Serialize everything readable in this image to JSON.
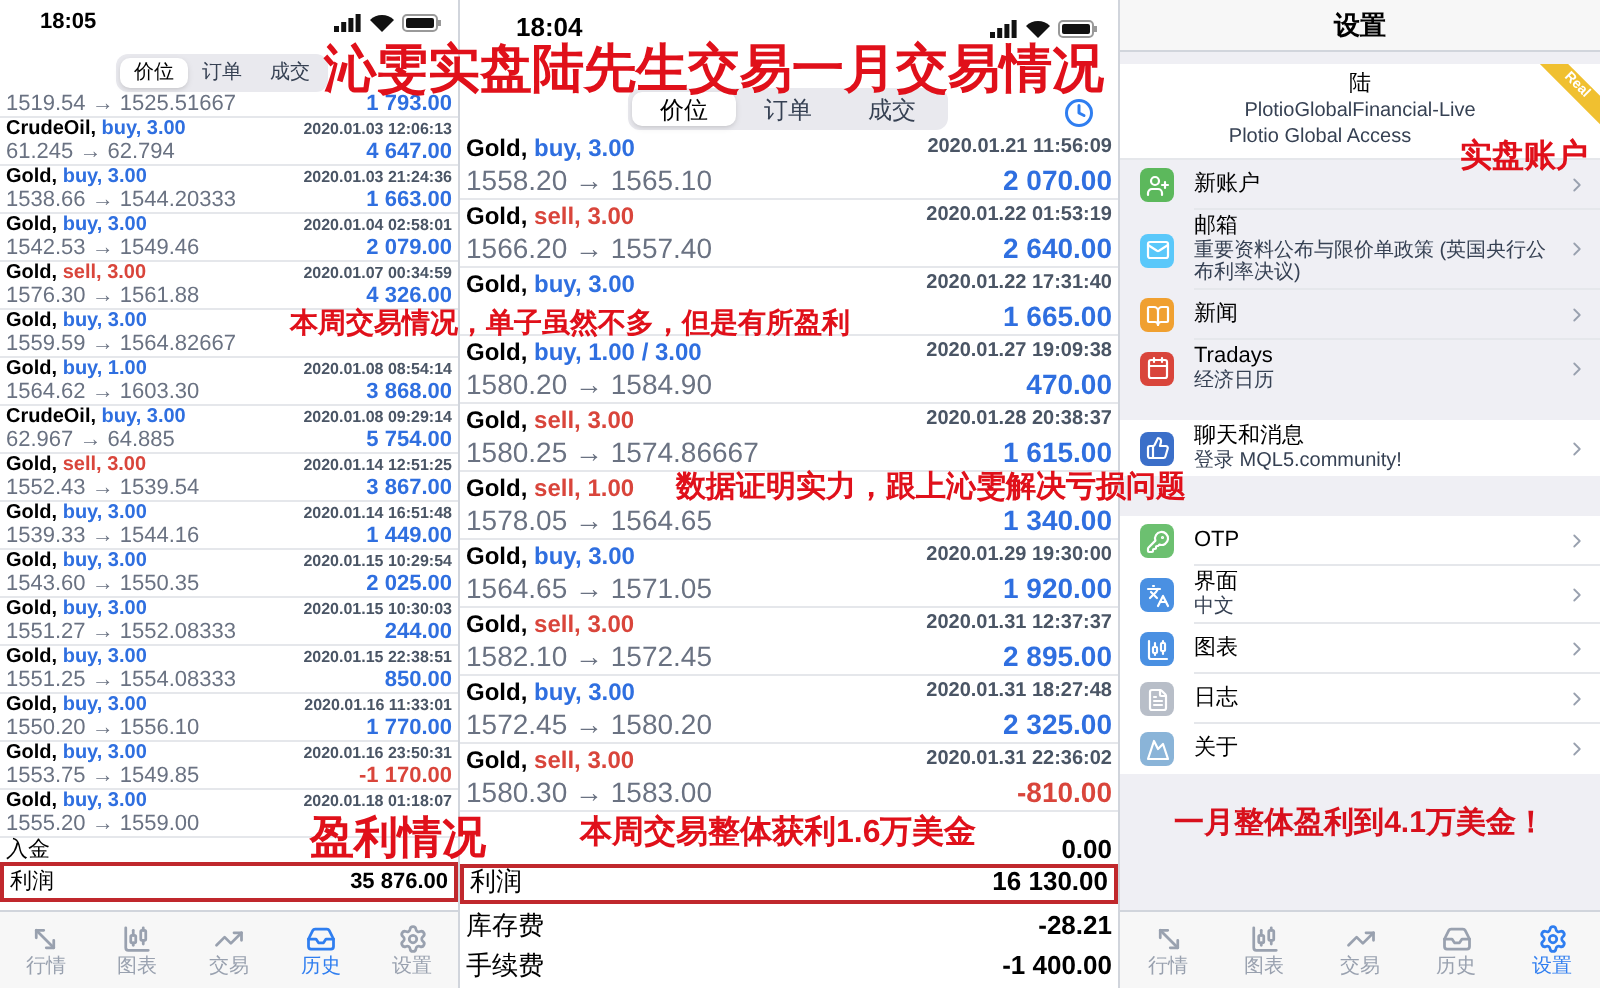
{
  "headline": "沁雯实盘陆先生交易一月交易情况",
  "captions": [
    "本周交易情况，单子虽然不多，但是有所盈利",
    "数据证明实力，跟上沁雯解决亏损问题",
    "盈利情况",
    "本周交易整体获利1.6万美金",
    "实盘账户"
  ],
  "left_phone": {
    "status_time": "18:05",
    "tabs": [
      {
        "label": "价位",
        "selected": true
      },
      {
        "label": "订单",
        "selected": false
      },
      {
        "label": "成交",
        "selected": false
      }
    ],
    "trades": [
      {
        "prices": "1519.54 → 1525.51667",
        "profit": "1 793.00",
        "loss": false
      },
      {
        "symbol": "CrudeOil,",
        "order": "buy, 3.00",
        "kind": "buy",
        "time": "2020.01.03 12:06:13",
        "prices": "61.245 → 62.794",
        "profit": "4 647.00",
        "loss": false
      },
      {
        "symbol": "Gold,",
        "order": "buy, 3.00",
        "kind": "buy",
        "time": "2020.01.03 21:24:36",
        "prices": "1538.66 → 1544.20333",
        "profit": "1 663.00",
        "loss": false
      },
      {
        "symbol": "Gold,",
        "order": "buy, 3.00",
        "kind": "buy",
        "time": "2020.01.04 02:58:01",
        "prices": "1542.53 → 1549.46",
        "profit": "2 079.00",
        "loss": false
      },
      {
        "symbol": "Gold,",
        "order": "sell, 3.00",
        "kind": "sell",
        "time": "2020.01.07 00:34:59",
        "prices": "1576.30 → 1561.88",
        "profit": "4 326.00",
        "loss": false
      },
      {
        "symbol": "Gold,",
        "order": "buy, 3.00",
        "kind": "buy",
        "prices": "1559.59 → 1564.82667"
      },
      {
        "symbol": "Gold,",
        "order": "buy, 1.00",
        "kind": "buy",
        "time": "2020.01.08 08:54:14",
        "prices": "1564.62 → 1603.30",
        "profit": "3 868.00",
        "loss": false
      },
      {
        "symbol": "CrudeOil,",
        "order": "buy, 3.00",
        "kind": "buy",
        "time": "2020.01.08 09:29:14",
        "prices": "62.967 → 64.885",
        "profit": "5 754.00",
        "loss": false
      },
      {
        "symbol": "Gold,",
        "order": "sell, 3.00",
        "kind": "sell",
        "time": "2020.01.14 12:51:25",
        "prices": "1552.43 → 1539.54",
        "profit": "3 867.00",
        "loss": false
      },
      {
        "symbol": "Gold,",
        "order": "buy, 3.00",
        "kind": "buy",
        "time": "2020.01.14 16:51:48",
        "prices": "1539.33 → 1544.16",
        "profit": "1 449.00",
        "loss": false
      },
      {
        "symbol": "Gold,",
        "order": "buy, 3.00",
        "kind": "buy",
        "time": "2020.01.15 10:29:54",
        "prices": "1543.60 → 1550.35",
        "profit": "2 025.00",
        "loss": false
      },
      {
        "symbol": "Gold,",
        "order": "buy, 3.00",
        "kind": "buy",
        "time": "2020.01.15 10:30:03",
        "prices": "1551.27 → 1552.08333",
        "profit": "244.00",
        "loss": false
      },
      {
        "symbol": "Gold,",
        "order": "buy, 3.00",
        "kind": "buy",
        "time": "2020.01.15 22:38:51",
        "prices": "1551.25 → 1554.08333",
        "profit": "850.00",
        "loss": false
      },
      {
        "symbol": "Gold,",
        "order": "buy, 3.00",
        "kind": "buy",
        "time": "2020.01.16 11:33:01",
        "prices": "1550.20 → 1556.10",
        "profit": "1 770.00",
        "loss": false
      },
      {
        "symbol": "Gold,",
        "order": "buy, 3.00",
        "kind": "buy",
        "time": "2020.01.16 23:50:31",
        "prices": "1553.75 → 1549.85",
        "profit": "-1 170.00",
        "loss": true
      },
      {
        "symbol": "Gold,",
        "order": "buy, 3.00",
        "kind": "buy",
        "time": "2020.01.18 01:18:07",
        "prices": "1555.20 → 1559.00"
      }
    ],
    "summary": [
      {
        "label": "入金",
        "highlighted": false
      },
      {
        "label": "利润",
        "value": "35 876.00",
        "highlighted": true
      }
    ],
    "tab_bar": [
      {
        "label": "行情",
        "selected": false
      },
      {
        "label": "图表",
        "selected": false
      },
      {
        "label": "交易",
        "selected": false
      },
      {
        "label": "历史",
        "selected": true
      },
      {
        "label": "设置",
        "selected": false
      }
    ]
  },
  "middle_phone": {
    "status_time": "18:04",
    "tabs": [
      {
        "label": "价位",
        "selected": true
      },
      {
        "label": "订单",
        "selected": false
      },
      {
        "label": "成交",
        "selected": false
      }
    ],
    "trades": [
      {
        "symbol": "Gold,",
        "order": "buy, 3.00",
        "kind": "buy",
        "time": "2020.01.21 11:56:09",
        "prices": "1558.20 → 1565.10",
        "profit": "2 070.00",
        "loss": false
      },
      {
        "symbol": "Gold,",
        "order": "sell, 3.00",
        "kind": "sell",
        "time": "2020.01.22 01:53:19",
        "prices": "1566.20 → 1557.40",
        "profit": "2 640.00",
        "loss": false
      },
      {
        "symbol": "Gold,",
        "order": "buy, 3.00",
        "kind": "buy",
        "time": "2020.01.22 17:31:40",
        "profit": "1 665.00",
        "loss": false
      },
      {
        "symbol": "Gold,",
        "order": "buy, 1.00 / 3.00",
        "kind": "buy",
        "time": "2020.01.27 19:09:38",
        "prices": "1580.20 → 1584.90",
        "profit": "470.00",
        "loss": false
      },
      {
        "symbol": "Gold,",
        "order": "sell, 3.00",
        "kind": "sell",
        "time": "2020.01.28 20:38:37",
        "prices": "1580.25 → 1574.86667",
        "profit": "1 615.00",
        "loss": false
      },
      {
        "symbol": "Gold,",
        "order": "sell, 1.00",
        "kind": "sell",
        "prices": "1578.05 → 1564.65",
        "profit": "1 340.00",
        "loss": false
      },
      {
        "symbol": "Gold,",
        "order": "buy, 3.00",
        "kind": "buy",
        "time": "2020.01.29 19:30:00",
        "prices": "1564.65 → 1571.05",
        "profit": "1 920.00",
        "loss": false
      },
      {
        "symbol": "Gold,",
        "order": "sell, 3.00",
        "kind": "sell",
        "time": "2020.01.31 12:37:37",
        "prices": "1582.10 → 1572.45",
        "profit": "2 895.00",
        "loss": false
      },
      {
        "symbol": "Gold,",
        "order": "buy, 3.00",
        "kind": "buy",
        "time": "2020.01.31 18:27:48",
        "prices": "1572.45 → 1580.20",
        "profit": "2 325.00",
        "loss": false
      },
      {
        "symbol": "Gold,",
        "order": "sell, 3.00",
        "kind": "sell",
        "time": "2020.01.31 22:36:02",
        "prices": "1580.30 → 1583.00",
        "profit": "-810.00",
        "loss": true
      }
    ],
    "summary": [
      {
        "value": "0.00",
        "highlighted": false
      },
      {
        "label": "利润",
        "value": "16 130.00",
        "highlighted": true
      },
      {
        "label": "库存费",
        "value": "-28.21",
        "highlighted": false
      },
      {
        "label": "手续费",
        "value": "-1 400.00",
        "highlighted": false
      }
    ]
  },
  "right_phone": {
    "title": "设置",
    "account": {
      "name": "陆",
      "server": "PlotioGlobalFinancial-Live",
      "company": "Plotio Global Access",
      "badge": "Real"
    },
    "menu_groups": [
      [
        {
          "title": "新账户"
        },
        {
          "title": "邮箱",
          "subtitle": "重要资料公布与限价单政策 (英国央行公布利率决议)"
        },
        {
          "title": "新闻"
        },
        {
          "title": "Tradays",
          "subtitle": "经济日历"
        }
      ],
      [
        {
          "title": "聊天和消息",
          "subtitle": "登录 MQL5.community!"
        }
      ],
      [
        {
          "title": "OTP"
        },
        {
          "title": "界面",
          "subtitle": "中文"
        },
        {
          "title": "图表"
        },
        {
          "title": "日志"
        },
        {
          "title": "关于"
        }
      ]
    ],
    "banner": "一月整体盈利到4.1万美金！",
    "tab_bar": [
      {
        "label": "行情",
        "selected": false
      },
      {
        "label": "图表",
        "selected": false
      },
      {
        "label": "交易",
        "selected": false
      },
      {
        "label": "历史",
        "selected": false
      },
      {
        "label": "设置",
        "selected": true
      }
    ]
  }
}
